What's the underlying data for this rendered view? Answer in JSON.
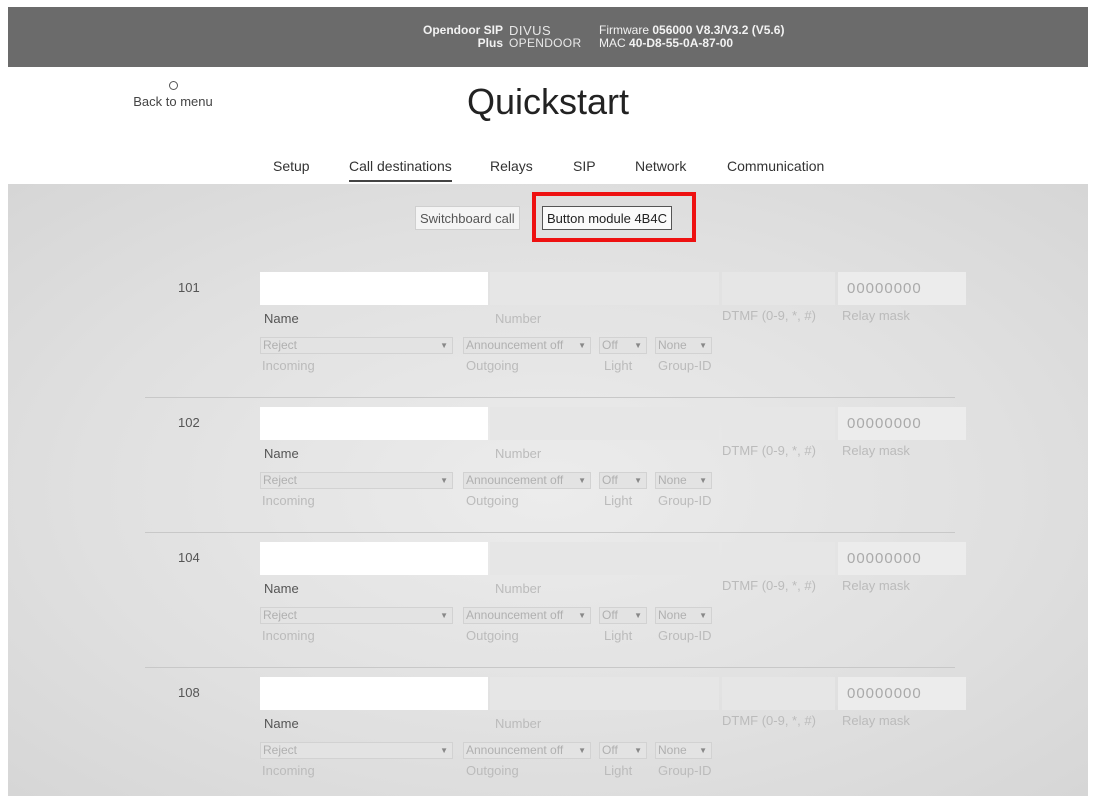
{
  "topbar": {
    "product_line1": "Opendoor SIP",
    "product_line2": "Plus",
    "logo_line1": "DIVUS",
    "logo_line2": "OPENDOOR",
    "firmware_prefix": "Firmware",
    "firmware_value": "056000 V8.3/V3.2 (V5.6)",
    "mac_prefix": "MAC",
    "mac_value": "40-D8-55-0A-87-00",
    "background_color": "#6b6b6b"
  },
  "header": {
    "back_label": "Back to menu",
    "title": "Quickstart"
  },
  "tabs": [
    {
      "label": "Setup",
      "active": false
    },
    {
      "label": "Call destinations",
      "active": true
    },
    {
      "label": "Relays",
      "active": false
    },
    {
      "label": "SIP",
      "active": false
    },
    {
      "label": "Network",
      "active": false
    },
    {
      "label": "Communication",
      "active": false
    }
  ],
  "subtabs": [
    {
      "label": "Switchboard call",
      "active": false
    },
    {
      "label": "Button module 4B4C",
      "active": true
    }
  ],
  "highlight_color": "#ee1111",
  "field_labels": {
    "name": "Name",
    "number": "Number",
    "dtmf": "DTMF (0-9, *, #)",
    "relay": "Relay mask",
    "incoming": "Incoming",
    "outgoing": "Outgoing",
    "light": "Light",
    "group": "Group-ID"
  },
  "entries": [
    {
      "id": "101",
      "relay_placeholder": "00000000",
      "incoming": "Reject",
      "outgoing": "Announcement off",
      "light": "Off",
      "group": "None"
    },
    {
      "id": "102",
      "relay_placeholder": "00000000",
      "incoming": "Reject",
      "outgoing": "Announcement off",
      "light": "Off",
      "group": "None"
    },
    {
      "id": "104",
      "relay_placeholder": "00000000",
      "incoming": "Reject",
      "outgoing": "Announcement off",
      "light": "Off",
      "group": "None"
    },
    {
      "id": "108",
      "relay_placeholder": "00000000",
      "incoming": "Reject",
      "outgoing": "Announcement off",
      "light": "Off",
      "group": "None"
    }
  ]
}
